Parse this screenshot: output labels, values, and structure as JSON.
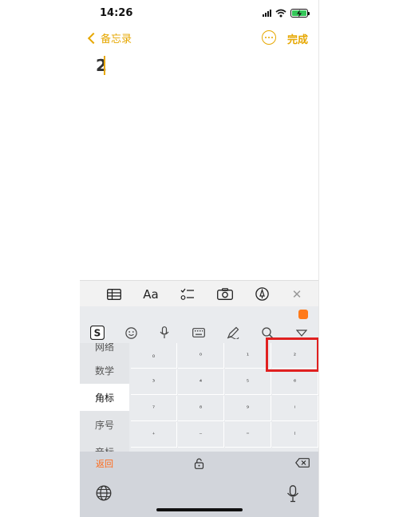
{
  "status_bar": {
    "time": "14:26"
  },
  "nav": {
    "back_label": "备忘录",
    "done_label": "完成"
  },
  "note": {
    "content": "2"
  },
  "format_toolbar": {
    "text_style_label": "Aa",
    "close_glyph": "✕"
  },
  "keyboard": {
    "categories": [
      "网络",
      "数学",
      "角标",
      "序号",
      "音标"
    ],
    "active_category": "角标",
    "symbols": [
      [
        "₀",
        "⁰",
        "¹",
        "²"
      ],
      [
        "³",
        "⁴",
        "⁵",
        "⁶"
      ],
      [
        "⁷",
        "⁸",
        "⁹",
        "ⁱ"
      ],
      [
        "⁺",
        "⁻",
        "⁼",
        "⁽"
      ]
    ],
    "return_label": "返回",
    "accent_color": "#ff6a1a"
  },
  "highlight": {
    "color": "#e02020",
    "target_symbol": "²"
  },
  "icons": {
    "table": "table-icon",
    "checklist": "checklist-icon",
    "camera": "camera-icon",
    "markup": "markup-pen-icon",
    "sogou": "sogou-logo",
    "emoji": "emoji-icon",
    "mic": "microphone-icon",
    "keyboard": "keyboard-icon",
    "handwrite": "handwriting-icon",
    "search": "search-icon",
    "hide": "hide-keyboard-icon",
    "globe": "globe-icon",
    "lock": "lock-icon",
    "delete": "delete-icon"
  }
}
